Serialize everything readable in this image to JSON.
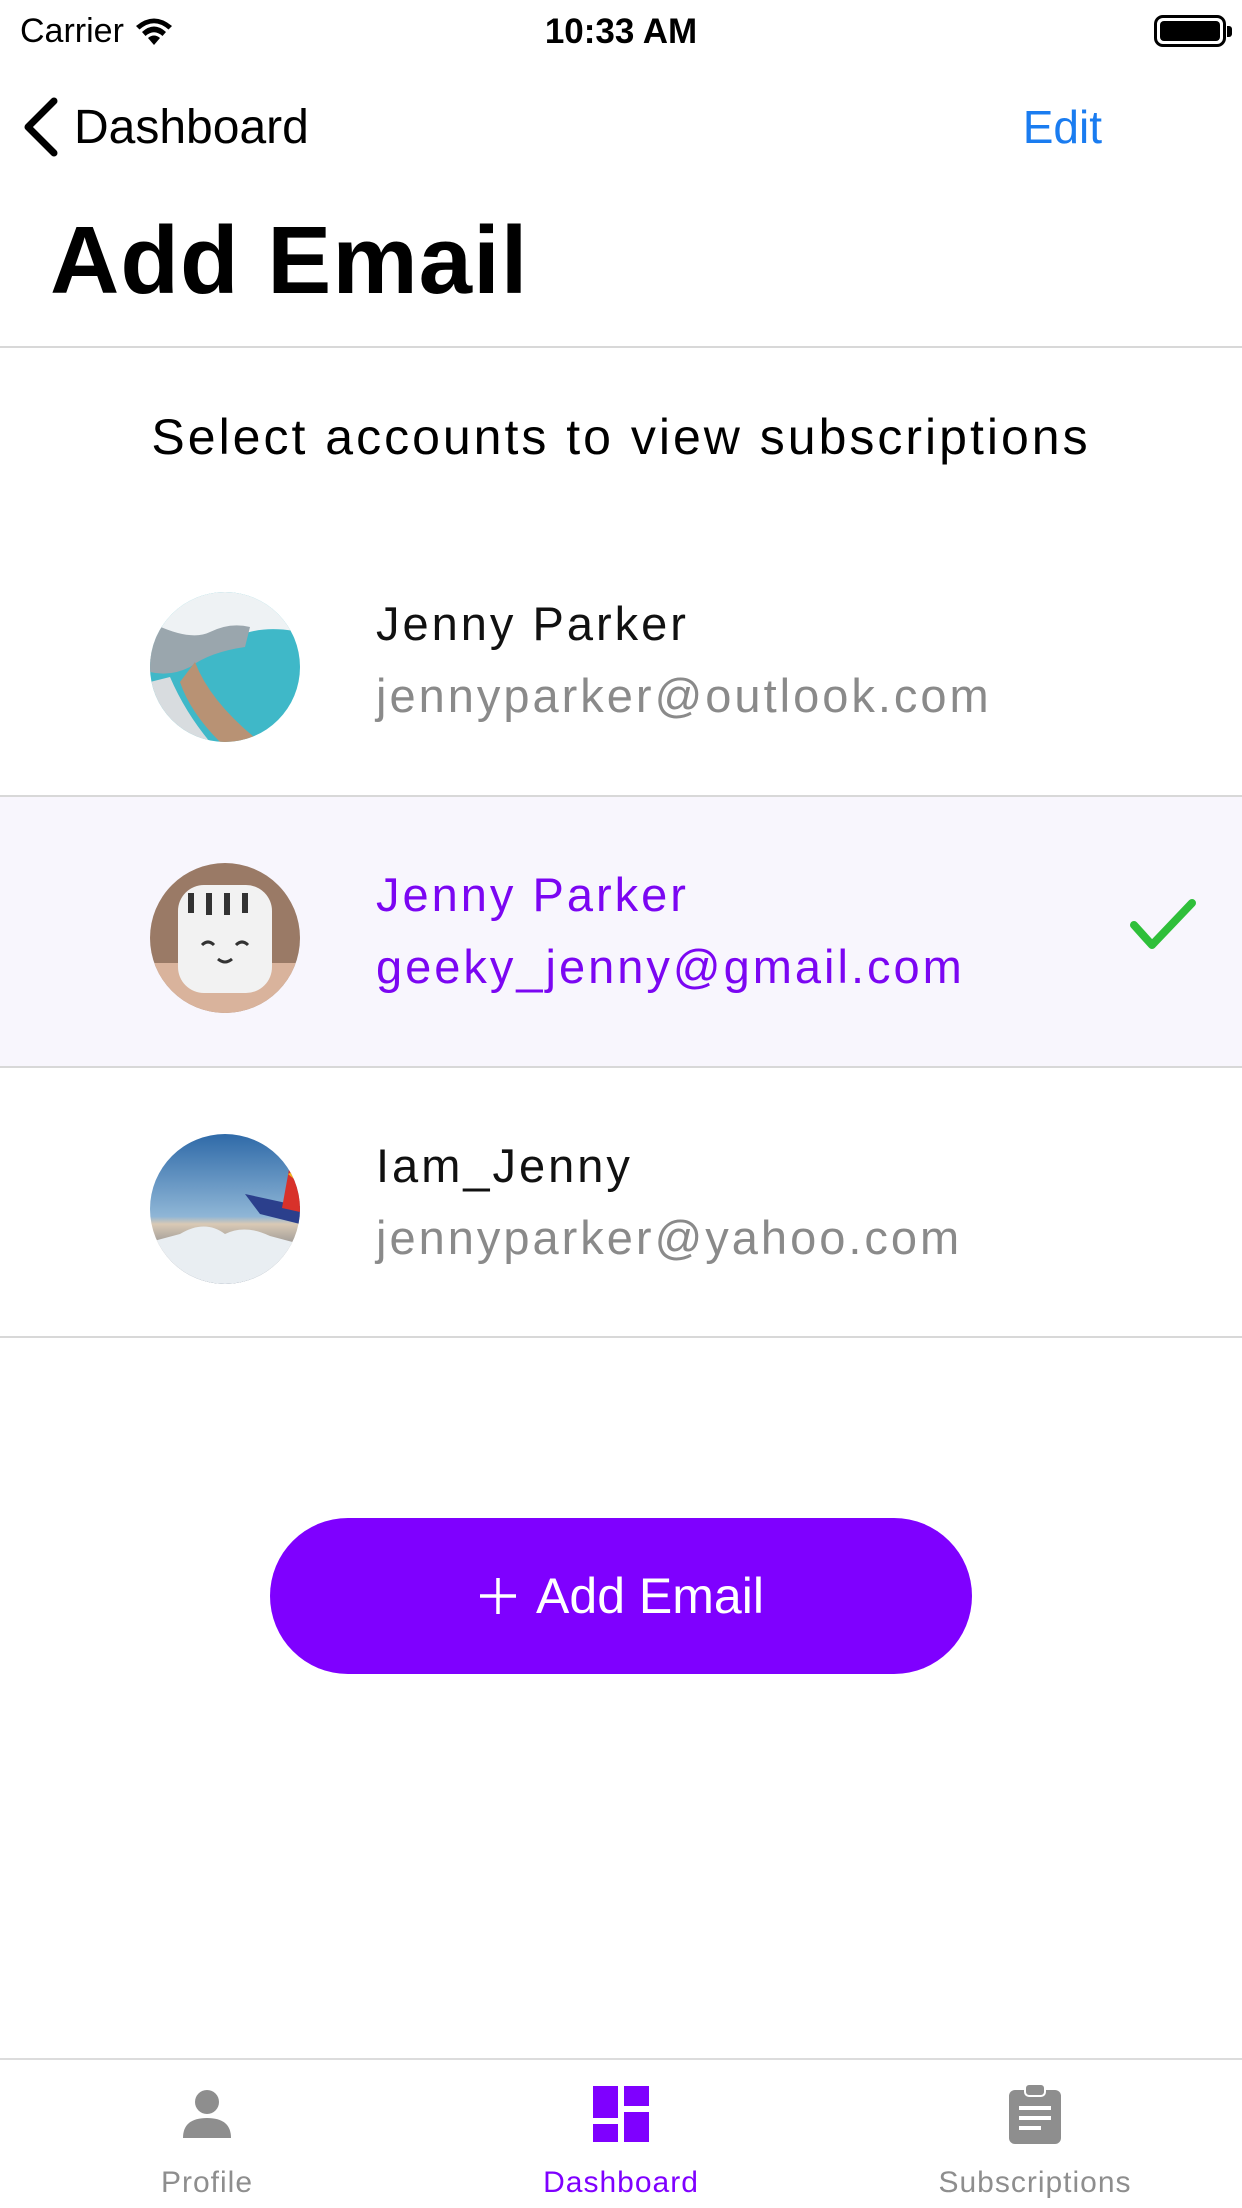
{
  "status_bar": {
    "carrier": "Carrier",
    "time": "10:33 AM"
  },
  "nav": {
    "back_label": "Dashboard",
    "edit_label": "Edit"
  },
  "page": {
    "title": "Add Email",
    "subtitle": "Select accounts to view subscriptions"
  },
  "accounts": [
    {
      "name": "Jenny Parker",
      "email": "jennyparker@outlook.com",
      "selected": false,
      "avatar": "beach-photo"
    },
    {
      "name": "Jenny Parker",
      "email": "geeky_jenny@gmail.com",
      "selected": true,
      "avatar": "cat-mug-photo"
    },
    {
      "name": "Iam_Jenny",
      "email": "jennyparker@yahoo.com",
      "selected": false,
      "avatar": "airplane-wing-photo"
    }
  ],
  "add_button": {
    "label": "Add Email",
    "icon": "plus-icon"
  },
  "tabs": [
    {
      "label": "Profile",
      "icon": "person-icon",
      "active": false
    },
    {
      "label": "Dashboard",
      "icon": "dashboard-icon",
      "active": true
    },
    {
      "label": "Subscriptions",
      "icon": "clipboard-icon",
      "active": false
    }
  ],
  "colors": {
    "accent": "#7f00ff",
    "selected_text": "#7b06f2",
    "selected_row_bg": "#f8f6fd",
    "link_blue": "#1a7cf0",
    "check_green": "#2fbf3a",
    "inactive_tab": "#8e8e8e"
  }
}
